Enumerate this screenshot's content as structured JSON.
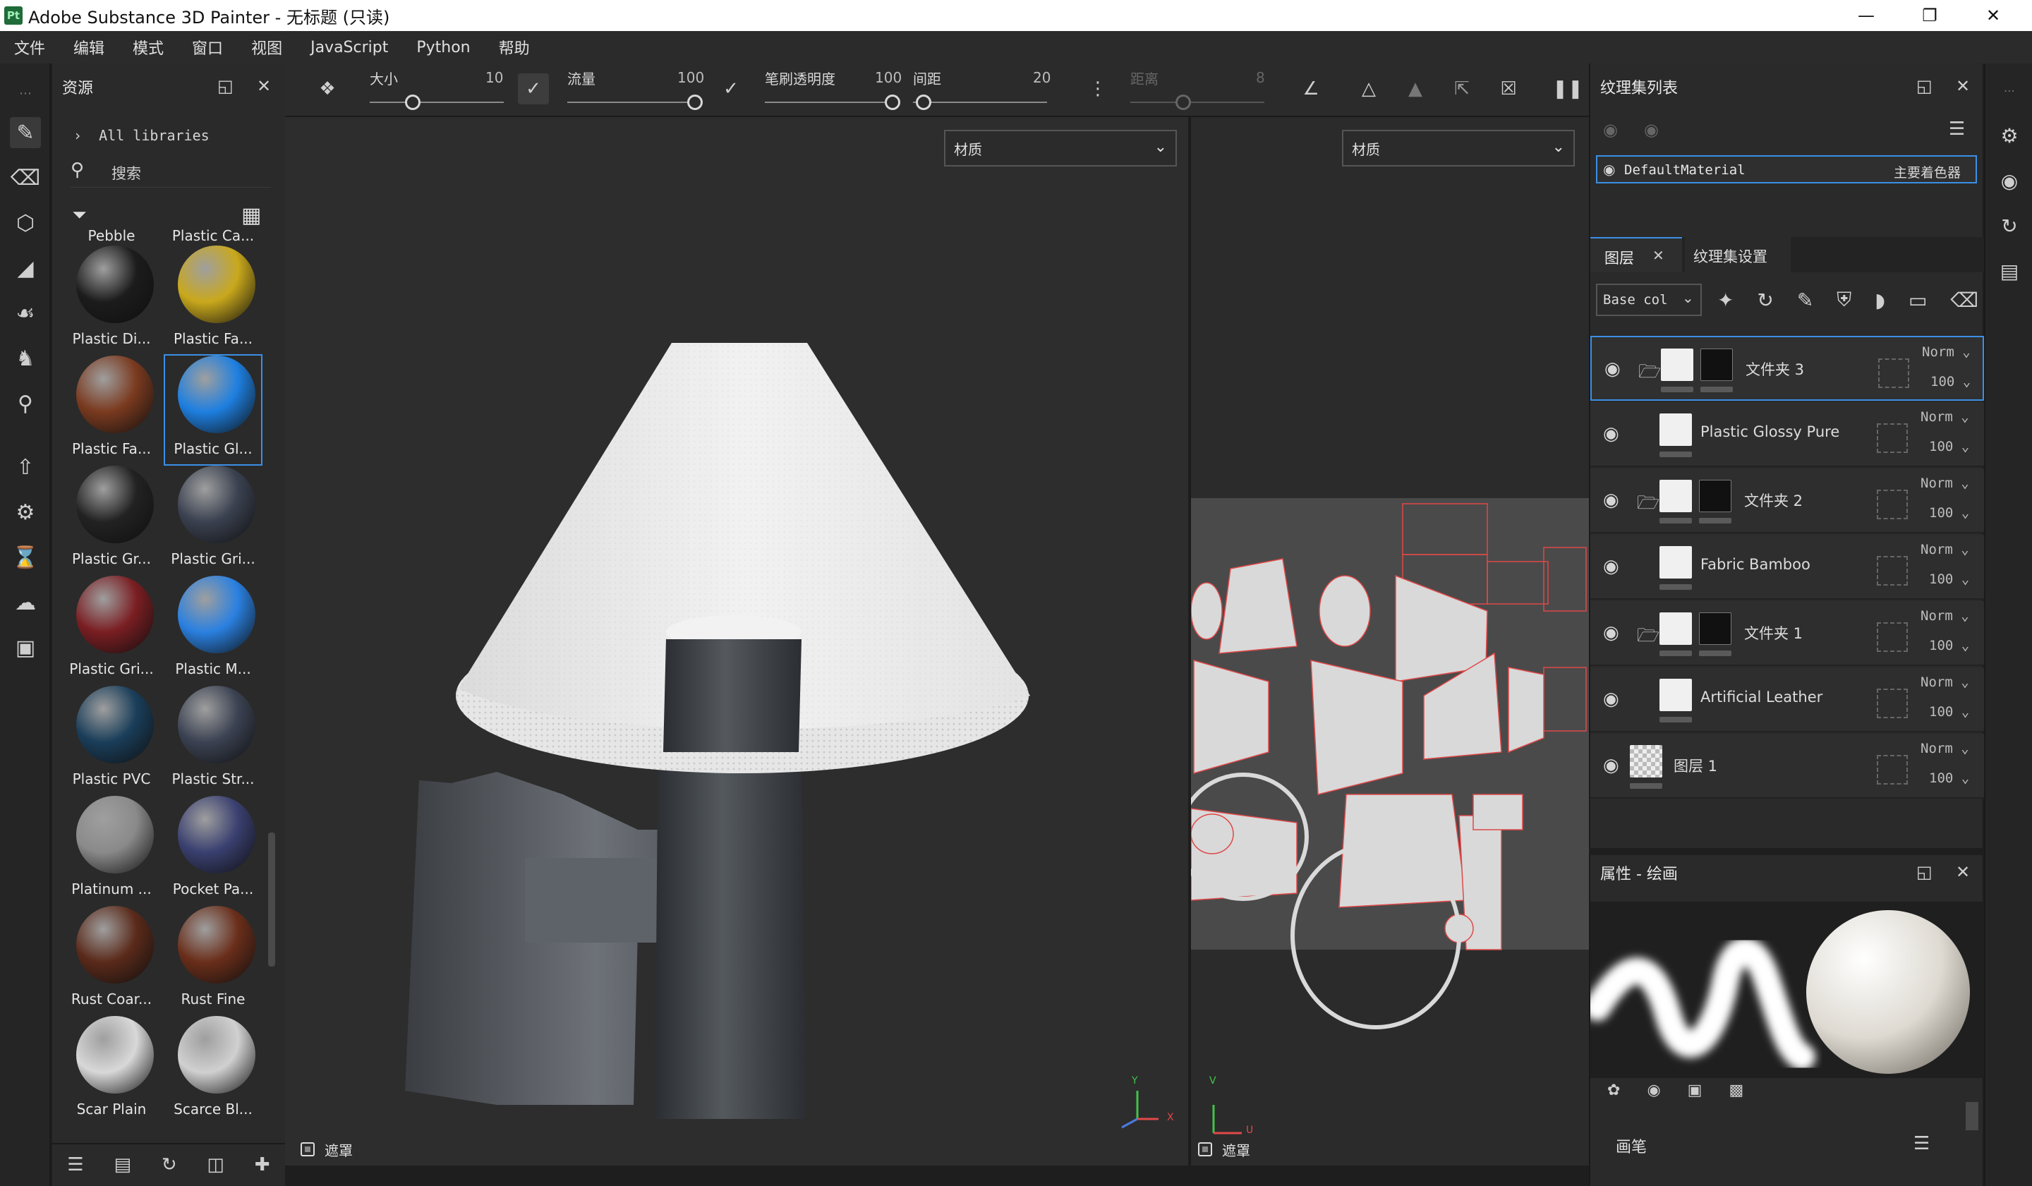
{
  "window": {
    "app_icon": "Pt",
    "title": "Adobe Substance 3D Painter - 无标题 (只读)",
    "minimize_icon": "minimize-icon",
    "restore_icon": "restore-icon",
    "close_icon": "close-icon"
  },
  "menu": [
    "文件",
    "编辑",
    "模式",
    "窗口",
    "视图",
    "JavaScript",
    "Python",
    "帮助"
  ],
  "assets_panel": {
    "title": "资源",
    "library": "All libraries",
    "search_placeholder": "搜索",
    "items": [
      {
        "label": "Pebble",
        "color": "#4a4a4a"
      },
      {
        "label": "Plastic Ca...",
        "color": "#5a5a5a"
      },
      {
        "label": "Plastic Di...",
        "color": "#1c1c1c"
      },
      {
        "label": "Plastic Fa...",
        "color": "#c9a81c"
      },
      {
        "label": "Plastic Fa...",
        "color": "#7a3a1f"
      },
      {
        "label": "Plastic Gl...",
        "color": "#1e7fe0"
      },
      {
        "label": "Plastic Gr...",
        "color": "#222222"
      },
      {
        "label": "Plastic Gri...",
        "color": "#3a4150"
      },
      {
        "label": "Plastic Gri...",
        "color": "#7a1e22"
      },
      {
        "label": "Plastic M...",
        "color": "#2a80e0"
      },
      {
        "label": "Plastic PVC",
        "color": "#1a3e5a"
      },
      {
        "label": "Plastic Str...",
        "color": "#3b4252"
      },
      {
        "label": "Platinum ...",
        "color": "#8a8a8a"
      },
      {
        "label": "Pocket Pa...",
        "color": "#3a4070"
      },
      {
        "label": "Rust Coar...",
        "color": "#5a2a1a"
      },
      {
        "label": "Rust Fine",
        "color": "#6a2e1a"
      },
      {
        "label": "Scar Plain",
        "color": "#d8d8d8"
      },
      {
        "label": "Scarce Bl...",
        "color": "#d0d0d0"
      }
    ],
    "selected_index": 5
  },
  "toolbar": {
    "size_label": "大小",
    "size_value": "10",
    "flow_label": "流量",
    "flow_value": "100",
    "opacity_label": "笔刷透明度",
    "opacity_value": "100",
    "spacing_label": "间距",
    "spacing_value": "20",
    "distance_label": "距离",
    "distance_value": "8"
  },
  "viewport3d": {
    "mode": "材质",
    "mask_label": "遮罩"
  },
  "viewport2d": {
    "mode": "材质",
    "mask_label": "遮罩"
  },
  "texture_sets": {
    "title": "纹理集列表",
    "item_name": "DefaultMaterial",
    "item_shader": "主要着色器"
  },
  "layers_panel": {
    "tab_layers": "图层",
    "tab_settings": "纹理集设置",
    "channel": "Base col",
    "layers": [
      {
        "name": "文件夹 3",
        "folder": true,
        "blend": "Norm",
        "opacity": "100",
        "selected": true
      },
      {
        "name": "Plastic Glossy Pure",
        "folder": false,
        "blend": "Norm",
        "opacity": "100"
      },
      {
        "name": "文件夹 2",
        "folder": true,
        "blend": "Norm",
        "opacity": "100"
      },
      {
        "name": "Fabric Bamboo",
        "folder": false,
        "blend": "Norm",
        "opacity": "100"
      },
      {
        "name": "文件夹 1",
        "folder": true,
        "blend": "Norm",
        "opacity": "100"
      },
      {
        "name": "Artificial Leather",
        "folder": false,
        "blend": "Norm",
        "opacity": "100"
      },
      {
        "name": "图层 1",
        "folder": false,
        "blend": "Norm",
        "opacity": "100"
      }
    ]
  },
  "properties": {
    "title": "属性 - 绘画",
    "brush_label": "画笔"
  },
  "axis": {
    "y": "Y",
    "x": "X",
    "u": "U",
    "v": "V"
  }
}
